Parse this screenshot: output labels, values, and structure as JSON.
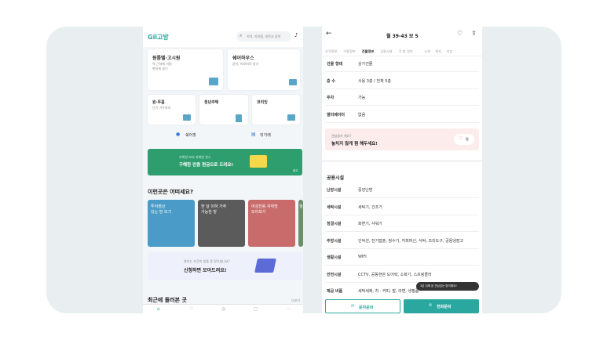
{
  "left": {
    "logo": "Gil고방",
    "search_placeholder": "지역, 지하철, 대학교 검색",
    "cat1": {
      "title": "원룸텔·고시원",
      "sub1": "역 근처에 저렴",
      "sub2": "편하게 살기"
    },
    "cat2": {
      "title": "쉐어하우스",
      "sub": "같이, 따로따로 살기"
    },
    "cat3": {
      "title": "원·투룸",
      "sub": "단기 거주까지"
    },
    "cat4": {
      "title": "청년주택"
    },
    "cat5": {
      "title": "코리빙"
    },
    "quick1": "쉐어팟",
    "quick2": "직거래",
    "banner_small": "자취방 보러 자취방 찬스",
    "banner_big": "구해한 만큼 현금으로 드려요!",
    "banner_badge": "광고",
    "section_title": "이런곳은 어떠세요?",
    "thumbs": [
      "투어영상\n있는 방 보기",
      "한 달 이하 거주\n가능한 방",
      "여성전용 자취방\n모아보기",
      "월"
    ],
    "cta_small": "원하는 조건의 방을 못 찾으셨나요?",
    "cta_big": "신청하면 모아드려요!",
    "recent_title": "최근에 둘러본 곳",
    "recent_more": "더보기"
  },
  "right": {
    "title": "월 39-43 보 5",
    "tabs": [
      "가격정보",
      "이용정보",
      "건물정보",
      "공용시설",
      "각 방 정보",
      "소개",
      "위치",
      "리뷰"
    ],
    "active_tab": 2,
    "rows": [
      {
        "k": "건물 형태",
        "v": "상가건물"
      },
      {
        "k": "층 수",
        "v": "사용 3층 / 전체 5층"
      },
      {
        "k": "주차",
        "v": "가능"
      },
      {
        "k": "엘리베이터",
        "v": "없음"
      }
    ],
    "promo_small": "괜찮을까 해요?",
    "promo_big": "놓치지 않게 찜 해두세요!",
    "promo_btn": "찜",
    "section": "공용시설",
    "rows2": [
      {
        "k": "난방시설",
        "v": "중앙난방"
      },
      {
        "k": "세탁시설",
        "v": "세탁기, 건조기"
      },
      {
        "k": "청결시설",
        "v": "화변기, 샤워기"
      },
      {
        "k": "주방시설",
        "v": "인덕션, 전기밥솥, 정수기, 커피머신, 식탁, 조리도구, 공용냉장고"
      },
      {
        "k": "생활시설",
        "v": "WIFI"
      },
      {
        "k": "안전시설",
        "v": "CCTV, 공동현관 도어락, 소화기, 스프링클러"
      },
      {
        "k": "제공 비품",
        "v": "세탁세제, 차 · 커피, 밥, 라면, 생필품"
      }
    ],
    "toast": "3분 뒤에 본 관심있는 방이예요!",
    "btn_msg": "문자문의",
    "btn_call": "전화문의"
  }
}
